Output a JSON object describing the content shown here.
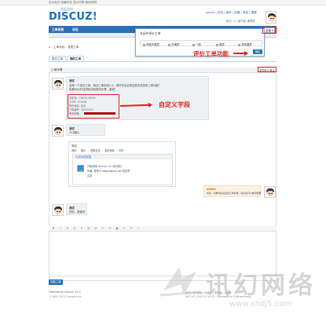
{
  "topbar": {
    "links": "设为首页  收藏本站  显示切换  使用说明"
  },
  "logo": {
    "cn": "社区动力",
    "en": "DISCUZ!"
  },
  "user": {
    "line1": "admin  |  在线  |  我的  |  设置  |  消息  |  提醒",
    "line2": "积分: 1  |  用户组: 管理员"
  },
  "nav": {
    "items": [
      "工单系统",
      "论坛"
    ]
  },
  "breadcrumb": "⌂  ›  工单系统  ›  查看工单",
  "tabs": [
    "提交工单",
    "我的工单"
  ],
  "popup": {
    "title": "关闭并评价工单",
    "close": "×",
    "options": [
      "非常不满意",
      "不满意",
      "一般",
      "满意",
      "非常满意"
    ],
    "ok": "确定",
    "dropdown": "结束 ▾"
  },
  "annotations": {
    "ticket_feature": "评价工单功能",
    "custom_fields": "自定义字段"
  },
  "panel": {
    "title": "工单详情",
    "status_link": "关闭此工单 ▸"
  },
  "messages": [
    {
      "name": "测试",
      "lines": [
        "这是一个测试工单，测试工单系统1.0，请问在后台是否能完成发布工单功能？",
        "如果可以的话请告诉我具体步骤，谢谢！"
      ]
    },
    {
      "name": "测试",
      "lines": [
        "123图片"
      ]
    }
  ],
  "fields": [
    "手机号: 13800138000",
    "QQ号: 123456",
    "所在地区: 北京",
    "订单编号: 20150501",
    "联系邮箱: "
  ],
  "card": {
    "header": "测试",
    "links": [
      "资料",
      "相片",
      "查看日志",
      "发送消息",
      "共享"
    ],
    "bar": "已成功的回复",
    "title": "开始使用 Discuz! X3 (测试版)",
    "meta": "作者: 发布于 www.discuz.net 的文章",
    "tag": "主题"
  },
  "reply_admin": {
    "name": "admin",
    "text": "您好，请参考后台设置工单系统，提交后可以看到结果"
  },
  "reply_user": {
    "name": "测试",
    "text": "好的，谢谢您"
  },
  "toolbar": [
    "B",
    "I",
    "U",
    "A",
    "✎",
    "☺",
    "⇄",
    "✄",
    "☍",
    "▣",
    "↶",
    "↷",
    "⛶"
  ],
  "submit": "回复工单",
  "footer": {
    "left1": "Powered by Discuz! X3.2",
    "left2": "© 2001-2013 Comsenz Inc.",
    "right1": "搜索 | 官方帮助 | 中文版 | 手机版 | 小黑屋",
    "right2": "GMT+8, 2015-5-5 18:25 , Processed in 0.06 second(s)"
  },
  "watermark": {
    "big": "讯幻网络",
    "url": "www.xhdj5.com"
  },
  "colors": {
    "brand": "#2b6fb5",
    "annotation": "#e02020"
  }
}
